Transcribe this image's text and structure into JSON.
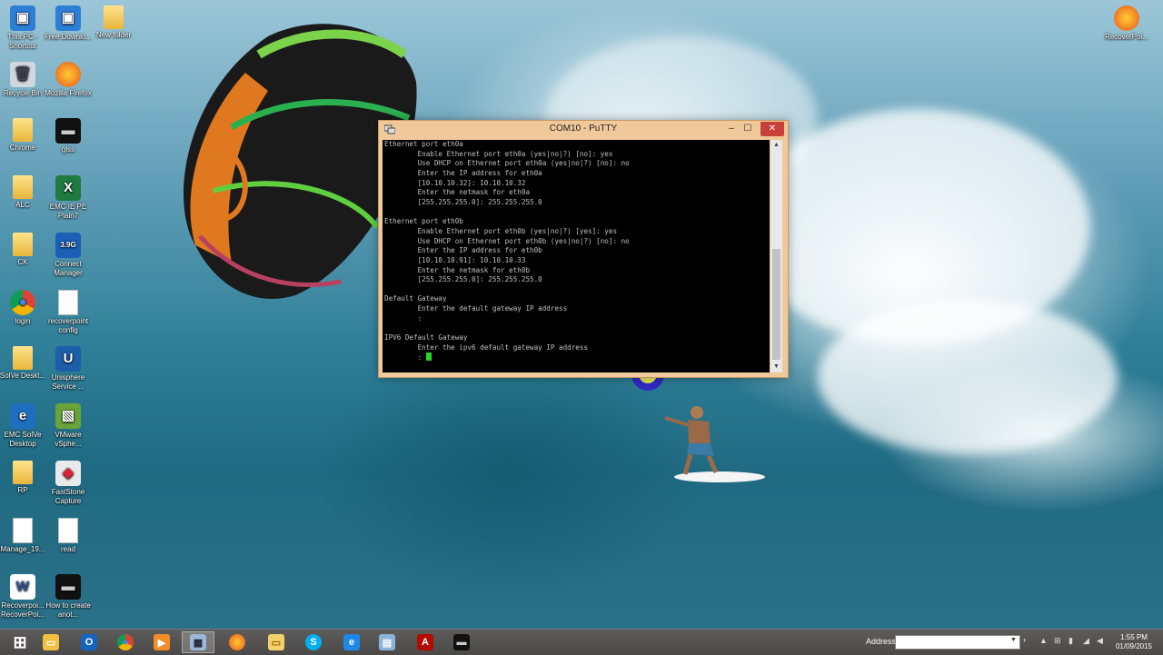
{
  "desktop_icons": [
    {
      "id": "this-pc",
      "label": "This PC - Shortcut",
      "kind": "pc"
    },
    {
      "id": "free-download",
      "label": "Free Downlo...",
      "kind": "pc"
    },
    {
      "id": "new-folder",
      "label": "New folder",
      "kind": "folder"
    },
    {
      "id": "recycle-bin",
      "label": "Recycle Bin",
      "kind": "bin"
    },
    {
      "id": "firefox",
      "label": "Mozilla Firefox",
      "kind": "firefox"
    },
    {
      "id": "chrome-folder",
      "label": "Chrome",
      "kind": "folder"
    },
    {
      "id": "glss",
      "label": "glss",
      "kind": "terminal"
    },
    {
      "id": "alc",
      "label": "ALC",
      "kind": "folder"
    },
    {
      "id": "emc-ie",
      "label": "EMC IE PE Plain7",
      "kind": "excel"
    },
    {
      "id": "ck",
      "label": "CK",
      "kind": "folder"
    },
    {
      "id": "connect-manager",
      "label": "Connect Manager",
      "kind": "3g"
    },
    {
      "id": "login",
      "label": "login",
      "kind": "chrome"
    },
    {
      "id": "recoverpoint-config",
      "label": "recoverpoint config",
      "kind": "doc"
    },
    {
      "id": "solve-desktop",
      "label": "SolVe Deskt...",
      "kind": "folder"
    },
    {
      "id": "unisphere",
      "label": "Unisphere Service ...",
      "kind": "unisphere"
    },
    {
      "id": "emc-solve",
      "label": "EMC SolVe Desktop",
      "kind": "emc"
    },
    {
      "id": "vmware",
      "label": "VMware vSphe...",
      "kind": "vmware"
    },
    {
      "id": "rp",
      "label": "RP",
      "kind": "folder"
    },
    {
      "id": "faststone",
      "label": "FastStone Capture",
      "kind": "faststone"
    },
    {
      "id": "manage",
      "label": "Manage_19...",
      "kind": "doc"
    },
    {
      "id": "read",
      "label": "read",
      "kind": "doc"
    },
    {
      "id": "recoverpoint-word",
      "label": "Recoverpoi... RecoverPoi...",
      "kind": "word"
    },
    {
      "id": "how-to",
      "label": "How to create anot...",
      "kind": "terminal"
    },
    {
      "id": "recoverpoint-ff",
      "label": "RecoverPoi...",
      "kind": "firefox"
    }
  ],
  "putty": {
    "title": "COM10 - PuTTY",
    "min_label": "–",
    "max_label": "☐",
    "close_label": "✕",
    "lines": [
      "Ethernet port eth0a",
      "        Enable Ethernet port eth0a (yes|no|?) [no]: yes",
      "        Use DHCP on Ethernet port eth0a (yes|no|?) [no]: no",
      "        Enter the IP address for eth0a",
      "        [10.10.10.32]: 10.10.10.32",
      "        Enter the netmask for eth0a",
      "        [255.255.255.0]: 255.255.255.0",
      "",
      "Ethernet port eth0b",
      "        Enable Ethernet port eth0b (yes|no|?) [yes]: yes",
      "        Use DHCP on Ethernet port eth0b (yes|no|?) [no]: no",
      "        Enter the IP address for eth0b",
      "        [10.10.10.91]: 10.10.10.33",
      "        Enter the netmask for eth0b",
      "        [255.255.255.0]: 255.255.255.0",
      "",
      "Default Gateway",
      "        Enter the default gateway IP address",
      "        :",
      "",
      "IPV6 Default Gateway",
      "        Enter the ipv6 default gateway IP address"
    ],
    "prompt": "        : "
  },
  "taskbar": {
    "apps": [
      {
        "id": "start",
        "kind": "windows"
      },
      {
        "id": "explorer",
        "kind": "explorer"
      },
      {
        "id": "outlook",
        "kind": "outlook"
      },
      {
        "id": "chrome",
        "kind": "chrome"
      },
      {
        "id": "media",
        "kind": "media"
      },
      {
        "id": "putty",
        "kind": "putty",
        "active": true
      },
      {
        "id": "firefox",
        "kind": "firefox"
      },
      {
        "id": "folder",
        "kind": "folder"
      },
      {
        "id": "skype",
        "kind": "skype"
      },
      {
        "id": "ie",
        "kind": "ie"
      },
      {
        "id": "files",
        "kind": "files"
      },
      {
        "id": "acrobat",
        "kind": "acrobat"
      },
      {
        "id": "cmd",
        "kind": "cmd"
      }
    ],
    "address_label": "Address",
    "address_value": "",
    "time": "1:55 PM",
    "date": "01/09/2015"
  },
  "colors": {
    "titlebar": "#f0c99a",
    "close": "#c7403a",
    "terminal_bg": "#000000",
    "terminal_fg": "#c0c0c0",
    "cursor": "#2bd02b"
  }
}
